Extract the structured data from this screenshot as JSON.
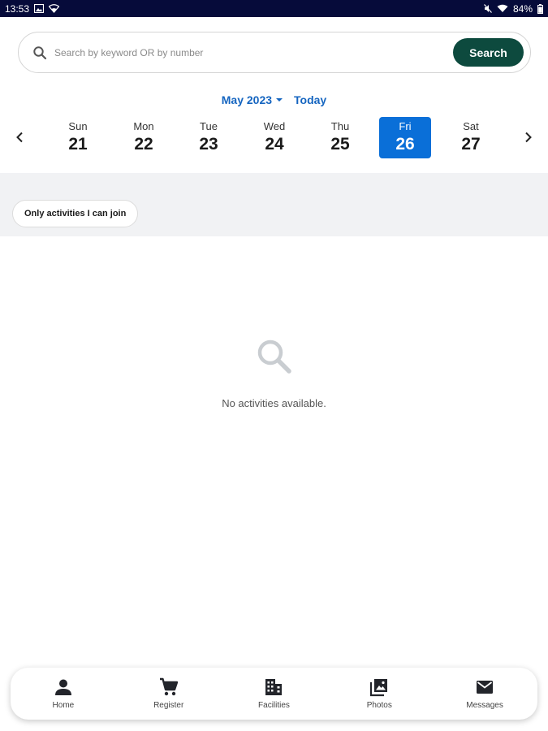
{
  "status_bar": {
    "time": "13:53",
    "battery": "84%",
    "icons": [
      "image-icon",
      "wifi-icon",
      "mute-icon",
      "signal-icon",
      "battery-icon"
    ]
  },
  "search": {
    "placeholder": "Search by keyword OR by number",
    "button_label": "Search"
  },
  "calendar": {
    "month_label": "May 2023",
    "today_label": "Today",
    "days": [
      {
        "name": "Sun",
        "num": "21"
      },
      {
        "name": "Mon",
        "num": "22"
      },
      {
        "name": "Tue",
        "num": "23"
      },
      {
        "name": "Wed",
        "num": "24"
      },
      {
        "name": "Thu",
        "num": "25"
      },
      {
        "name": "Fri",
        "num": "26"
      },
      {
        "name": "Sat",
        "num": "27"
      }
    ],
    "selected_day": "26"
  },
  "filter": {
    "chip_label": "Only activities I can join"
  },
  "empty_state": {
    "message": "No activities available."
  },
  "bottom_nav": {
    "items": [
      {
        "label": "Home",
        "icon": "person-icon"
      },
      {
        "label": "Register",
        "icon": "cart-icon"
      },
      {
        "label": "Facilities",
        "icon": "building-icon"
      },
      {
        "label": "Photos",
        "icon": "photo-library-icon"
      },
      {
        "label": "Messages",
        "icon": "mail-icon"
      }
    ]
  },
  "colors": {
    "status_bar": "#060b3a",
    "search_button": "#0d4a3e",
    "accent_link": "#1565c0",
    "selected_day": "#0a6fd8",
    "filter_band": "#f1f2f4"
  }
}
